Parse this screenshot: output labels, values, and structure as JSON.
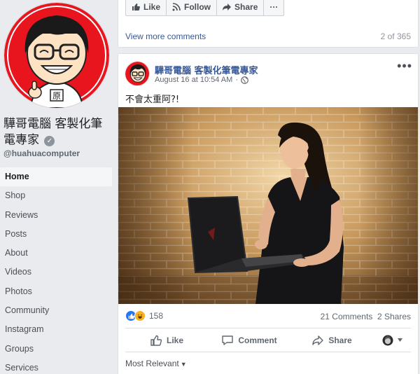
{
  "page": {
    "name": "驊哥電腦 客製化筆電專家",
    "handle": "@huahuacomputer",
    "verified_icon": "verified-badge-icon"
  },
  "nav": {
    "items": [
      {
        "label": "Home",
        "active": true
      },
      {
        "label": "Shop"
      },
      {
        "label": "Reviews"
      },
      {
        "label": "Posts"
      },
      {
        "label": "About"
      },
      {
        "label": "Videos"
      },
      {
        "label": "Photos"
      },
      {
        "label": "Community"
      },
      {
        "label": "Instagram"
      },
      {
        "label": "Groups"
      },
      {
        "label": "Services"
      }
    ]
  },
  "previous_post": {
    "actions": {
      "like": "Like",
      "follow": "Follow",
      "share": "Share",
      "more": "···"
    },
    "view_more_comments": "View more comments",
    "comment_count": "2 of 365"
  },
  "post": {
    "author": "驊哥電腦 客製化筆電專家",
    "timestamp": "August 16 at 10:54 AM",
    "privacy_icon": "globe-icon",
    "more": "•••",
    "text": "不會太重阿?!",
    "reactions": {
      "icons": [
        "like-reaction-icon",
        "haha-reaction-icon"
      ],
      "count": "158"
    },
    "comments_label": "21 Comments",
    "shares_label": "2 Shares",
    "actions": {
      "like": "Like",
      "comment": "Comment",
      "share": "Share"
    },
    "sort_label": "Most Relevant"
  },
  "colors": {
    "link": "#385898",
    "author": "#365899",
    "avatar_ring": "#e8141e",
    "like_blue": "#2078f4",
    "haha_yellow": "#f7b125",
    "background": "#e9ebee"
  }
}
